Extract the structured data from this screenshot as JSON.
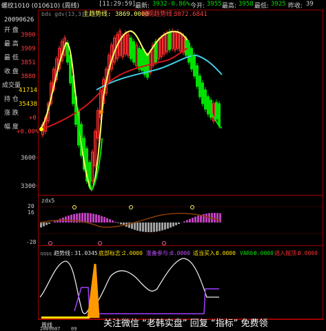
{
  "window": {
    "title": "螺纹1010 (010610) (周线)",
    "clock": "[11:29:59]",
    "latest_label": "最新:",
    "latest_value": "3932",
    "change_pct": "-0.86%",
    "open_label": "今开:",
    "open_value": "3955",
    "high_label": "最高:",
    "high_value": "3958",
    "low_label": "最低:",
    "low_value": "3925",
    "prevclose_label": "昨收:",
    "prevclose_value": "39"
  },
  "sidebar": {
    "date": "20090626",
    "open_label": "开  盘",
    "open_value": "3900",
    "high_label": "最  高",
    "high_value": "3909",
    "low_label": "最  低",
    "low_value": "3851",
    "close_label": "收  盘",
    "close_value": "3880",
    "volume_label": "成交量",
    "volume_value": "41714",
    "position_label": "持  仓",
    "position_value": "35438",
    "change_label": "涨  跌",
    "change_value": "+0",
    "amplitude_label": "幅  度",
    "amplitude_value": "+0.00%"
  },
  "main_panel": {
    "legend_prefix": "bds  gdv(13,3)",
    "legend_main_label": "主趋势线:",
    "legend_main_value": "3869.0000",
    "legend_short_label": "短期趋势线:",
    "legend_short_value": "3872.6841",
    "yticks": [
      "3600",
      "3300"
    ]
  },
  "mid_panel": {
    "label": "zdx5",
    "yticks": [
      "20",
      "16",
      "-28"
    ]
  },
  "bottom_panel": {
    "label": "qqqq",
    "trend_label": "趋势线:",
    "trend_value": "31.0345",
    "bottom_label": "底部标志:",
    "bottom_value": "2.0000",
    "prepare_label": "准备参与:",
    "prepare_value": "0.0000",
    "buy_label": "适当买入:",
    "buy_value": "0.0000",
    "var_label": "VAR6:",
    "var_value": "0.0000",
    "sell_label": "逃入抛顶:",
    "sell_value": "0.0000"
  },
  "xaxis": {
    "label": "周线",
    "ticks": [
      "2009007",
      "09"
    ]
  },
  "watermark": "关注微信 “老韩实盘” 回复 “指标” 免费领",
  "colors": {
    "up": "#ff3030",
    "down": "#00e000",
    "short_trend": "#ffff66",
    "main_trend": "#d01818",
    "ma": "#40d0e8",
    "frame": "#a00000"
  }
}
